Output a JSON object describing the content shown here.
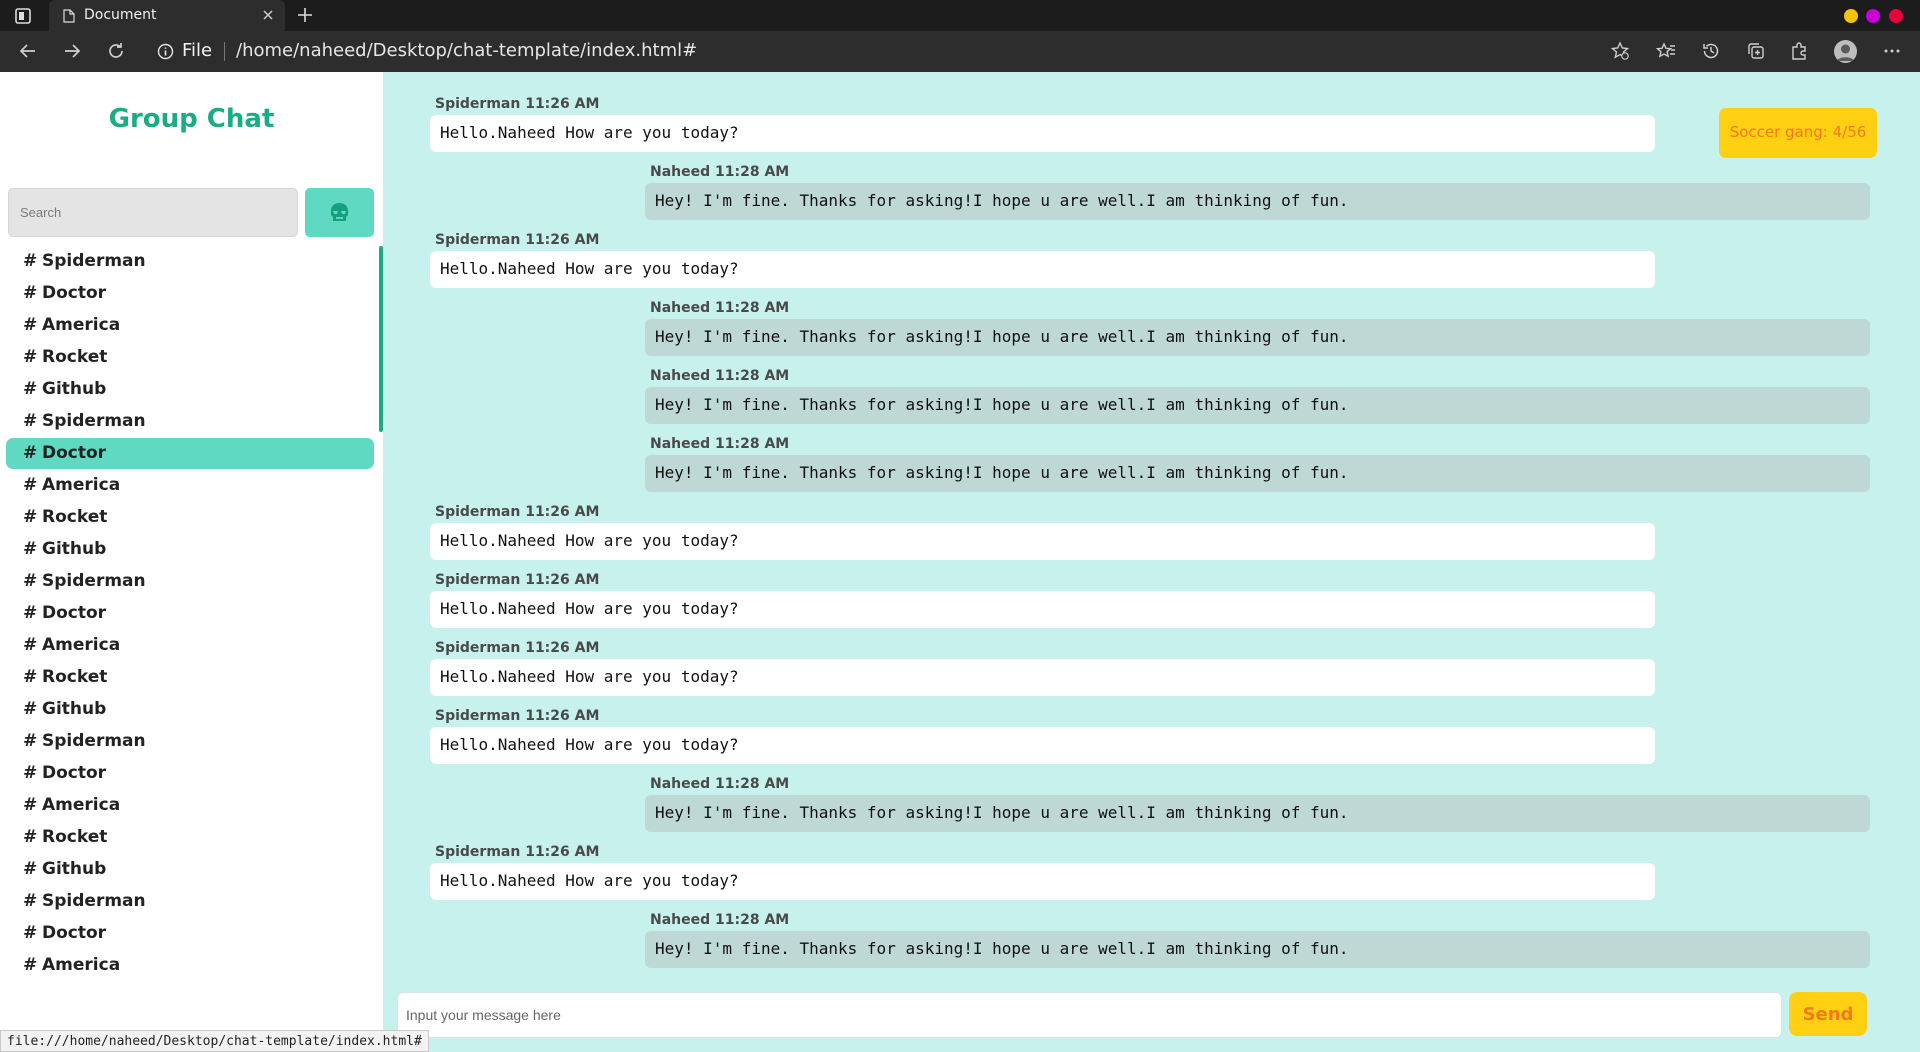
{
  "browser": {
    "tab_title": "Document",
    "url_scheme": "File",
    "url": "/home/naheed/Desktop/chat-template/index.html#",
    "status_url": "file:///home/naheed/Desktop/chat-template/index.html#",
    "window_controls": [
      "#f5c400",
      "#c800d6",
      "#e8003c"
    ]
  },
  "sidebar": {
    "title": "Group Chat",
    "search_placeholder": "Search",
    "hash": "#",
    "rooms": [
      {
        "name": "Spiderman",
        "active": false
      },
      {
        "name": "Doctor",
        "active": false
      },
      {
        "name": "America",
        "active": false
      },
      {
        "name": "Rocket",
        "active": false
      },
      {
        "name": "Github",
        "active": false
      },
      {
        "name": "Spiderman",
        "active": false
      },
      {
        "name": "Doctor",
        "active": true
      },
      {
        "name": "America",
        "active": false
      },
      {
        "name": "Rocket",
        "active": false
      },
      {
        "name": "Github",
        "active": false
      },
      {
        "name": "Spiderman",
        "active": false
      },
      {
        "name": "Doctor",
        "active": false
      },
      {
        "name": "America",
        "active": false
      },
      {
        "name": "Rocket",
        "active": false
      },
      {
        "name": "Github",
        "active": false
      },
      {
        "name": "Spiderman",
        "active": false
      },
      {
        "name": "Doctor",
        "active": false
      },
      {
        "name": "America",
        "active": false
      },
      {
        "name": "Rocket",
        "active": false
      },
      {
        "name": "Github",
        "active": false
      },
      {
        "name": "Spiderman",
        "active": false
      },
      {
        "name": "Doctor",
        "active": false
      },
      {
        "name": "America",
        "active": false
      }
    ]
  },
  "chat": {
    "group_badge": "Soccer gang: 4/56",
    "messages": [
      {
        "sender": "them",
        "meta": "Spiderman 11:26 AM",
        "text": "Hello.Naheed How are you today?"
      },
      {
        "sender": "me",
        "meta": "Naheed 11:28 AM",
        "text": "Hey! I'm fine. Thanks for asking!I hope u are well.I am thinking of fun."
      },
      {
        "sender": "them",
        "meta": "Spiderman 11:26 AM",
        "text": "Hello.Naheed How are you today?"
      },
      {
        "sender": "me",
        "meta": "Naheed 11:28 AM",
        "text": "Hey! I'm fine. Thanks for asking!I hope u are well.I am thinking of fun."
      },
      {
        "sender": "me",
        "meta": "Naheed 11:28 AM",
        "text": "Hey! I'm fine. Thanks for asking!I hope u are well.I am thinking of fun."
      },
      {
        "sender": "me",
        "meta": "Naheed 11:28 AM",
        "text": "Hey! I'm fine. Thanks for asking!I hope u are well.I am thinking of fun."
      },
      {
        "sender": "them",
        "meta": "Spiderman 11:26 AM",
        "text": "Hello.Naheed How are you today?"
      },
      {
        "sender": "them",
        "meta": "Spiderman 11:26 AM",
        "text": "Hello.Naheed How are you today?"
      },
      {
        "sender": "them",
        "meta": "Spiderman 11:26 AM",
        "text": "Hello.Naheed How are you today?"
      },
      {
        "sender": "them",
        "meta": "Spiderman 11:26 AM",
        "text": "Hello.Naheed How are you today?"
      },
      {
        "sender": "me",
        "meta": "Naheed 11:28 AM",
        "text": "Hey! I'm fine. Thanks for asking!I hope u are well.I am thinking of fun."
      },
      {
        "sender": "them",
        "meta": "Spiderman 11:26 AM",
        "text": "Hello.Naheed How are you today?"
      },
      {
        "sender": "me",
        "meta": "Naheed 11:28 AM",
        "text": "Hey! I'm fine. Thanks for asking!I hope u are well.I am thinking of fun."
      }
    ],
    "composer_placeholder": "Input your message here",
    "send_label": "Send"
  }
}
